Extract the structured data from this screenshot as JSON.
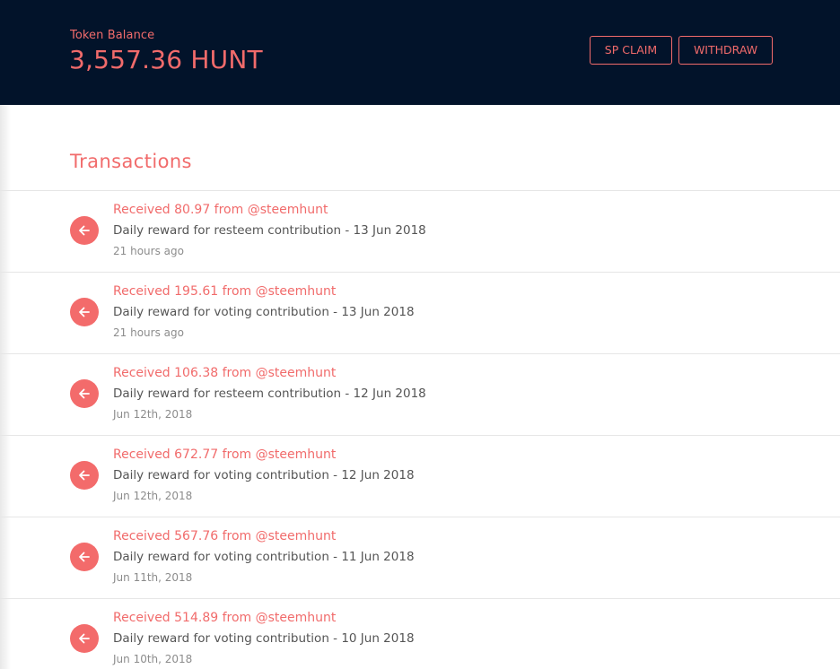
{
  "header": {
    "balance_label": "Token Balance",
    "balance_value": "3,557.36 HUNT",
    "sp_claim_label": "SP CLAIM",
    "withdraw_label": "WITHDRAW"
  },
  "transactions": {
    "title": "Transactions",
    "items": [
      {
        "title": "Received 80.97 from @steemhunt",
        "description": "Daily reward for resteem contribution - 13 Jun 2018",
        "time": "21 hours ago"
      },
      {
        "title": "Received 195.61 from @steemhunt",
        "description": "Daily reward for voting contribution - 13 Jun 2018",
        "time": "21 hours ago"
      },
      {
        "title": "Received 106.38 from @steemhunt",
        "description": "Daily reward for resteem contribution - 12 Jun 2018",
        "time": "Jun 12th, 2018"
      },
      {
        "title": "Received 672.77 from @steemhunt",
        "description": "Daily reward for voting contribution - 12 Jun 2018",
        "time": "Jun 12th, 2018"
      },
      {
        "title": "Received 567.76 from @steemhunt",
        "description": "Daily reward for voting contribution - 11 Jun 2018",
        "time": "Jun 11th, 2018"
      },
      {
        "title": "Received 514.89 from @steemhunt",
        "description": "Daily reward for voting contribution - 10 Jun 2018",
        "time": "Jun 10th, 2018"
      }
    ]
  },
  "icons": {
    "transaction_icon": "arrow-left-icon"
  },
  "colors": {
    "header_bg": "#02132a",
    "accent": "#f16b6b",
    "divider": "#e6e6e6"
  }
}
